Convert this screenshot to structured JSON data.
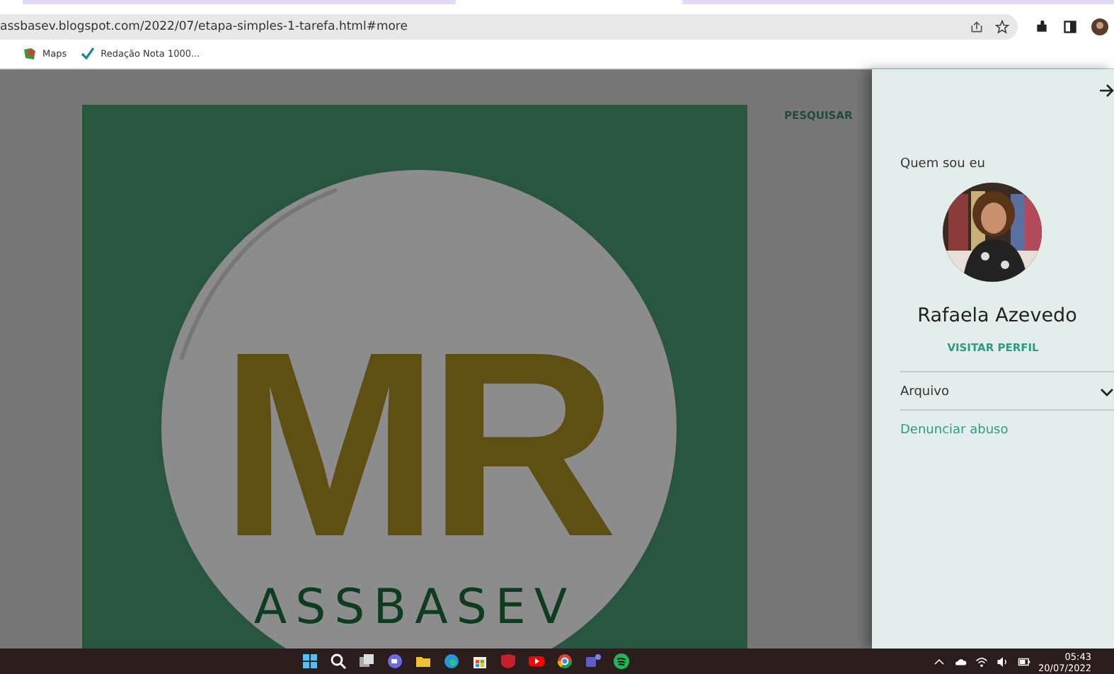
{
  "browser": {
    "url": "assbasev.blogspot.com/2022/07/etapa-simples-1-tarefa.html#more",
    "bookmarks": [
      {
        "kind": "maps",
        "label": "Maps"
      },
      {
        "kind": "check",
        "label": "Redação Nota 1000..."
      }
    ]
  },
  "page": {
    "logo": {
      "monogram": "MR",
      "name": "ASSBASEV"
    },
    "search_link": "PESQUISAR"
  },
  "sidebar": {
    "heading": "Quem sou eu",
    "profile_name": "Rafaela Azevedo",
    "profile_link": "VISITAR PERFIL",
    "archive": {
      "label": "Arquivo",
      "expanded": false
    },
    "report_link": "Denunciar abuso"
  },
  "taskbar": {
    "time": "05:43",
    "date": "20/07/2022"
  }
}
